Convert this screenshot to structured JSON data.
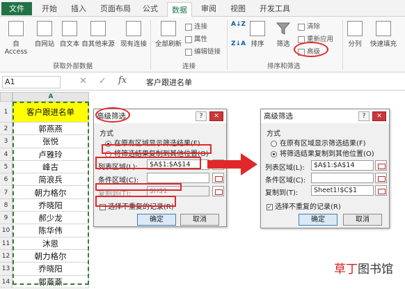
{
  "ribbon": {
    "tabs": [
      {
        "label": "文件",
        "key": "file"
      },
      {
        "label": "开始"
      },
      {
        "label": "插入"
      },
      {
        "label": "页面布局"
      },
      {
        "label": "公式"
      },
      {
        "label": "数据",
        "active": true
      },
      {
        "label": "审阅"
      },
      {
        "label": "视图"
      },
      {
        "label": "开发工具"
      }
    ],
    "external_group": {
      "buttons": [
        "自 Access",
        "自网站",
        "自文本",
        "自其他来源",
        "现有连接"
      ],
      "label": "获取外部数据"
    },
    "connections_group": {
      "refresh_label": "全部刷新",
      "items": [
        "连接",
        "属性",
        "编辑链接"
      ],
      "label": "连接"
    },
    "sort_group": {
      "sort_az": "A↓Z",
      "sort_za": "Z↓A",
      "sort_label": "排序",
      "filter_label": "筛选",
      "clear_label": "清除",
      "reapply_label": "重新应用",
      "advanced_label": "高级",
      "label": "排序和筛选"
    },
    "tools": [
      "分列",
      "快速填充"
    ]
  },
  "formula_bar": {
    "name_box": "A1",
    "fx": "fx",
    "cancel": "✕",
    "enter": "✓",
    "value": "客户跟进名单"
  },
  "sheet": {
    "column_header": "A",
    "rows": [
      {
        "n": "1",
        "v": "客户跟进名单",
        "header": true
      },
      {
        "n": "2",
        "v": "郭燕燕"
      },
      {
        "n": "3",
        "v": "张悦"
      },
      {
        "n": "4",
        "v": "卢雅玲"
      },
      {
        "n": "5",
        "v": "峰古"
      },
      {
        "n": "6",
        "v": "简浪兵"
      },
      {
        "n": "7",
        "v": "朝力格尔"
      },
      {
        "n": "8",
        "v": "乔晓阳"
      },
      {
        "n": "9",
        "v": "郝少龙"
      },
      {
        "n": "10",
        "v": "陈华伟"
      },
      {
        "n": "11",
        "v": "沐恩"
      },
      {
        "n": "12",
        "v": "朝力格尔"
      },
      {
        "n": "13",
        "v": "乔晓阳"
      },
      {
        "n": "14",
        "v": "郭燕燕"
      }
    ]
  },
  "dialog_before": {
    "title": "高级筛选",
    "help": "?",
    "close": "✕",
    "mode_label": "方式",
    "option_inplace": "在原有区域显示筛选结果(F)",
    "option_copy": "将筛选结果复制到其他位置(O)",
    "list_range_label": "列表区域(L):",
    "list_range_value": "$A$1:$A$14",
    "criteria_label": "条件区域(C):",
    "criteria_value": "",
    "copy_to_label": "复制到(T):",
    "copy_to_value": "$H$1",
    "unique_label": "选择不重复的记录(R)",
    "unique_checked": false,
    "ok": "确定",
    "cancel": "取消"
  },
  "dialog_after": {
    "title": "高级筛选",
    "help": "?",
    "close": "✕",
    "mode_label": "方式",
    "option_inplace": "在原有区域显示筛选结果(F)",
    "option_copy": "将筛选结果复制到其他位置(O)",
    "list_range_label": "列表区域(L):",
    "list_range_value": "$A$1:$A$14",
    "criteria_label": "条件区域(C):",
    "criteria_value": "",
    "copy_to_label": "复制到(T):",
    "copy_to_value": "Sheet1!$C$1",
    "unique_label": "选择不重复的记录(R)",
    "unique_checked": true,
    "check_mark": "✓",
    "ok": "确定",
    "cancel": "取消"
  },
  "watermark": {
    "part1": "草丁",
    "part2": "图书馆"
  },
  "colors": {
    "excel_green": "#217346",
    "highlight_yellow": "#ffff00",
    "annotation_red": "#e0282a"
  }
}
